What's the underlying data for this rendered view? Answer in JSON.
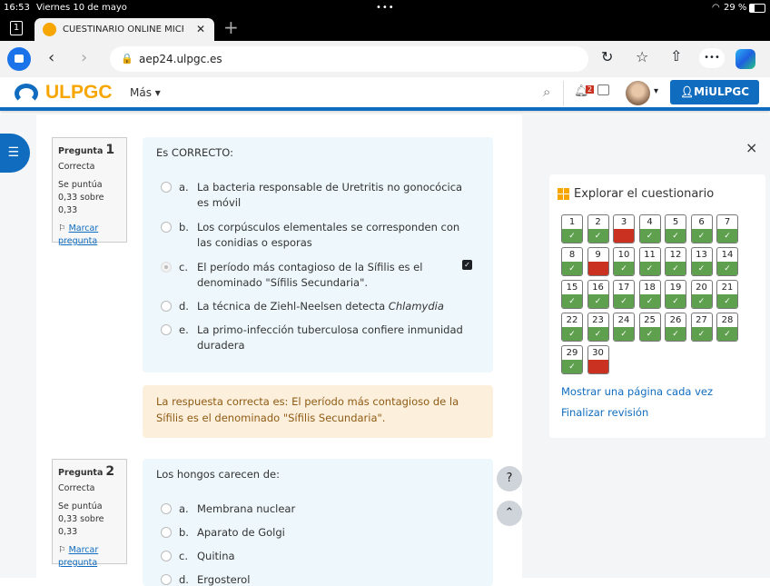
{
  "status": {
    "time": "16:53",
    "date": "Viernes 10 de mayo",
    "battery": "29 %"
  },
  "browser": {
    "tab_count": "1",
    "tab_title": "CUESTINARIO ONLINE MICRO",
    "url": "aep24.ulpgc.es"
  },
  "site": {
    "logo": "ULPGC",
    "more": "Más",
    "notifications": "2",
    "account": "MiULPGC"
  },
  "questions": [
    {
      "label": "Pregunta",
      "number": "1",
      "state": "Correcta",
      "grade": "Se puntúa 0,33 sobre 0,33",
      "flag": "Marcar pregunta",
      "prompt": "Es CORRECTO:",
      "options": [
        {
          "letter": "a.",
          "text": "La bacteria responsable de Uretritis no gonocócica es móvil"
        },
        {
          "letter": "b.",
          "text": "Los corpúsculos elementales se corresponden con las conidias o esporas"
        },
        {
          "letter": "c.",
          "text": "El período más contagioso de la Sífilis es el denominado \"Sífilis Secundaria\".",
          "selected": true
        },
        {
          "letter": "d.",
          "text": "La técnica de Ziehl-Neelsen detecta ",
          "italic": "Chlamydia"
        },
        {
          "letter": "e.",
          "text": "La primo-infección tuberculosa confiere inmunidad duradera"
        }
      ],
      "feedback": "La respuesta correcta es: El período más contagioso de la Sífilis es el denominado \"Sífilis Secundaria\"."
    },
    {
      "label": "Pregunta",
      "number": "2",
      "state": "Correcta",
      "grade": "Se puntúa 0,33 sobre 0,33",
      "flag": "Marcar pregunta",
      "prompt": "Los hongos carecen de:",
      "options": [
        {
          "letter": "a.",
          "text": "Membrana nuclear"
        },
        {
          "letter": "b.",
          "text": "Aparato de Golgi"
        },
        {
          "letter": "c.",
          "text": "Quitina"
        },
        {
          "letter": "d.",
          "text": "Ergosterol"
        }
      ]
    }
  ],
  "drawer": {
    "title": "Explorar el cuestionario",
    "show_one_page": "Mostrar una página cada vez",
    "finish_review": "Finalizar revisión",
    "close": "×",
    "incorrect": [
      3,
      9,
      30
    ],
    "total": 30
  },
  "help": {
    "question": "?",
    "up": "^"
  },
  "colors": {
    "correct": "#5fa04e",
    "incorrect": "#ca3120",
    "brand": "#0f6cbf",
    "logo_orange": "#f7a600"
  }
}
